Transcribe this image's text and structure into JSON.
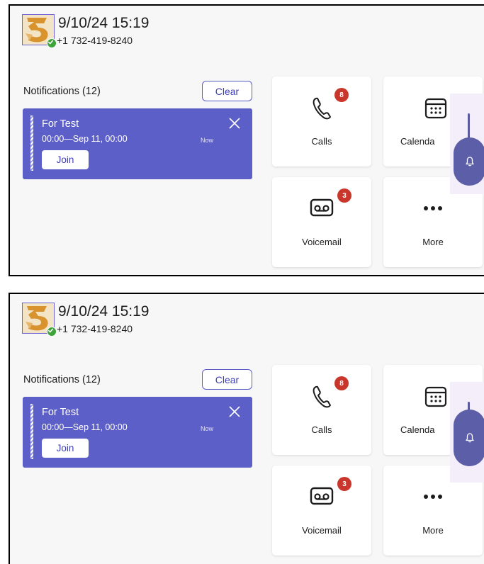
{
  "screens": [
    {
      "header": {
        "datetime": "9/10/24 15:19",
        "phone": "+1 732-419-8240"
      },
      "notifications": {
        "title": "Notifications (12)",
        "clear_label": "Clear",
        "card": {
          "title": "For Test",
          "time": "00:00—Sep 11, 00:00",
          "status": "Now",
          "join_label": "Join"
        }
      },
      "tiles": {
        "calls": {
          "label": "Calls",
          "badge": "8"
        },
        "calendar": {
          "label": "Calenda"
        },
        "voicemail": {
          "label": "Voicemail",
          "badge": "3"
        },
        "more": {
          "label": "More"
        }
      }
    },
    {
      "header": {
        "datetime": "9/10/24 15:19",
        "phone": "+1 732-419-8240"
      },
      "notifications": {
        "title": "Notifications (12)",
        "clear_label": "Clear",
        "card": {
          "title": "For Test",
          "time": "00:00—Sep 11, 00:00",
          "status": "Now",
          "join_label": "Join"
        }
      },
      "tiles": {
        "calls": {
          "label": "Calls",
          "badge": "8"
        },
        "calendar": {
          "label": "Calenda"
        },
        "voicemail": {
          "label": "Voicemail",
          "badge": "3"
        },
        "more": {
          "label": "More"
        }
      }
    }
  ],
  "icons": {
    "avatar": "avatar-image-icon",
    "presence": "available-check-icon",
    "close": "close-icon",
    "calls": "phone-icon",
    "calendar": "calendar-icon",
    "voicemail": "voicemail-icon",
    "more": "more-dots-icon",
    "bell": "bell-icon"
  },
  "colors": {
    "accent": "#5d5fc9",
    "badge": "#c9372c",
    "presence": "#3da33b",
    "bell_handle": "#5c5fa8"
  }
}
